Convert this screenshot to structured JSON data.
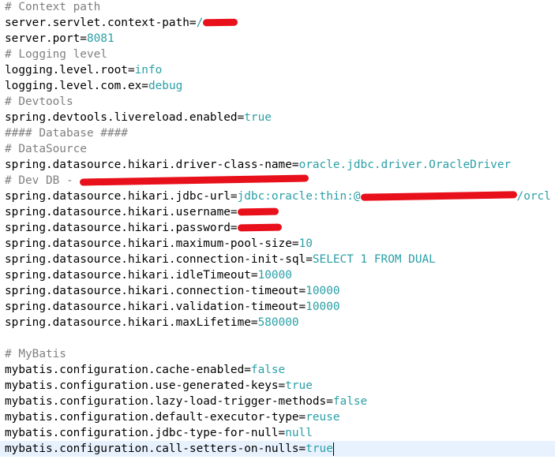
{
  "editor": {
    "lines": {
      "l01": {
        "comment": "# Context path"
      },
      "l02": {
        "key": "server.servlet.context-path=",
        "value": "/"
      },
      "l03": {
        "key": "server.port=",
        "value": "8081"
      },
      "l04": {
        "comment": "# Logging level"
      },
      "l05": {
        "key": "logging.level.root=",
        "value": "info"
      },
      "l06": {
        "key": "logging.level.com.ex=",
        "value": "debug"
      },
      "l07": {
        "comment": "# Devtools"
      },
      "l08": {
        "key": "spring.devtools.livereload.enabled=",
        "value": "true"
      },
      "l09": {
        "comment": "#### Database ####"
      },
      "l10": {
        "comment": "# DataSource"
      },
      "l11": {
        "key": "spring.datasource.hikari.driver-class-name=",
        "value": "oracle.jdbc.driver.OracleDriver"
      },
      "l12": {
        "comment": "# Dev DB - "
      },
      "l13": {
        "key": "spring.datasource.hikari.jdbc-url=",
        "value": "jdbc:oracle:thin:@",
        "value_after": "/orcl"
      },
      "l14": {
        "key": "spring.datasource.hikari.username="
      },
      "l15": {
        "key": "spring.datasource.hikari.password="
      },
      "l16": {
        "key": "spring.datasource.hikari.maximum-pool-size=",
        "value": "10"
      },
      "l17": {
        "key": "spring.datasource.hikari.connection-init-sql=",
        "value": "SELECT 1 FROM DUAL"
      },
      "l18": {
        "key": "spring.datasource.hikari.idleTimeout=",
        "value": "10000"
      },
      "l19": {
        "key": "spring.datasource.hikari.connection-timeout=",
        "value": "10000"
      },
      "l20": {
        "key": "spring.datasource.hikari.validation-timeout=",
        "value": "10000"
      },
      "l21": {
        "key": "spring.datasource.hikari.maxLifetime=",
        "value": "580000"
      },
      "l23": {
        "comment": "# MyBatis"
      },
      "l24": {
        "key": "mybatis.configuration.cache-enabled=",
        "value": "false"
      },
      "l25": {
        "key": "mybatis.configuration.use-generated-keys=",
        "value": "true"
      },
      "l26": {
        "key": "mybatis.configuration.lazy-load-trigger-methods=",
        "value": "false"
      },
      "l27": {
        "key": "mybatis.configuration.default-executor-type=",
        "value": "reuse"
      },
      "l28": {
        "key": "mybatis.configuration.jdbc-type-for-null=",
        "value": "null"
      },
      "l29": {
        "key": "mybatis.configuration.call-setters-on-nulls=",
        "value": "true"
      }
    },
    "colors": {
      "comment": "#808080",
      "value": "#2a9fa6",
      "redaction": "#e8101a",
      "current_line": "#e8f2fe"
    }
  }
}
